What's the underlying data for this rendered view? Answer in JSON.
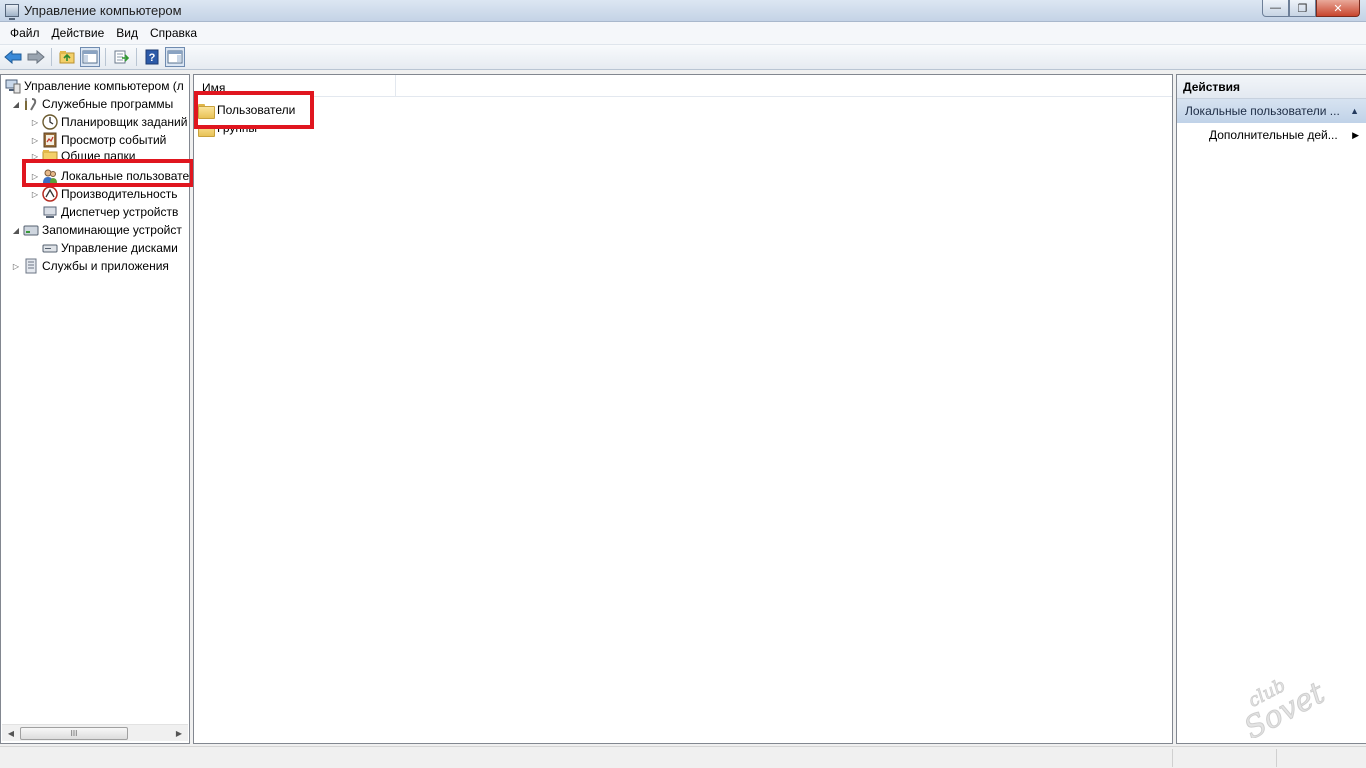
{
  "window": {
    "title": "Управление компьютером",
    "controls": {
      "minimize": "—",
      "maximize": "❐",
      "close": "✕"
    }
  },
  "menu": [
    "Файл",
    "Действие",
    "Вид",
    "Справка"
  ],
  "toolbar": {
    "icons": [
      "back-arrow-icon",
      "forward-arrow-icon",
      "up-folder-icon",
      "show-hide-tree-icon",
      "export-list-icon",
      "help-icon",
      "show-hide-action-pane-icon"
    ]
  },
  "tree": {
    "root": "Управление компьютером (л",
    "items": [
      {
        "label": "Служебные программы",
        "expander": "◢",
        "icon": "tools-icon"
      },
      {
        "label": "Планировщик заданий",
        "expander": "▷",
        "icon": "clock-icon"
      },
      {
        "label": "Просмотр событий",
        "expander": "▷",
        "icon": "event-viewer-icon"
      },
      {
        "label": "Общие папки",
        "expander": "▷",
        "icon": "shared-folder-icon"
      },
      {
        "label": "Локальные пользовате",
        "expander": "▷",
        "icon": "users-icon"
      },
      {
        "label": "Производительность",
        "expander": "▷",
        "icon": "performance-icon"
      },
      {
        "label": "Диспетчер устройств",
        "expander": "",
        "icon": "device-manager-icon"
      },
      {
        "label": "Запоминающие устройст",
        "expander": "◢",
        "icon": "storage-icon"
      },
      {
        "label": "Управление дисками",
        "expander": "",
        "icon": "disk-icon"
      },
      {
        "label": "Службы и приложения",
        "expander": "▷",
        "icon": "services-icon"
      }
    ],
    "scroll_thumb": "III"
  },
  "list": {
    "column": "Имя",
    "items": [
      "Пользователи",
      "Группы"
    ]
  },
  "actions": {
    "header": "Действия",
    "section": "Локальные пользователи ...",
    "item": "Дополнительные дей..."
  },
  "watermark": "club Sovet",
  "colors": {
    "highlight": "#e0161f",
    "selection": "#c0d2e8"
  }
}
